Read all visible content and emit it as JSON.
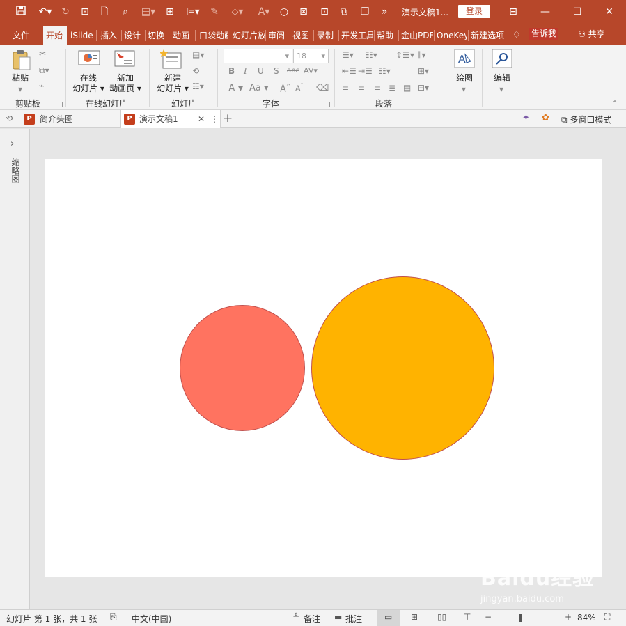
{
  "titlebar": {
    "doc_title": "演示文稿1...",
    "login": "登录"
  },
  "menu_tabs": [
    {
      "label": "文件"
    },
    {
      "label": "开始",
      "active": true
    },
    {
      "label": "iSlide"
    },
    {
      "label": "插入"
    },
    {
      "label": "设计"
    },
    {
      "label": "切换"
    },
    {
      "label": "动画"
    },
    {
      "label": "口袋动画"
    },
    {
      "label": "幻灯片放映"
    },
    {
      "label": "审阅"
    },
    {
      "label": "视图"
    },
    {
      "label": "录制"
    },
    {
      "label": "开发工具"
    },
    {
      "label": "帮助"
    },
    {
      "label": "金山PDF"
    },
    {
      "label": "OneKey"
    },
    {
      "label": "新建选项卡"
    }
  ],
  "tell_me": "告诉我",
  "share": "共享",
  "ribbon": {
    "paste": "粘贴",
    "clipboard": "剪贴板",
    "online_slide": [
      "在线",
      "幻灯片"
    ],
    "new_animation": [
      "新加",
      "动画页"
    ],
    "online_slide_group": "在线幻灯片",
    "new_slide": [
      "新建",
      "幻灯片"
    ],
    "slides_group": "幻灯片",
    "font_size": "18",
    "font_group": "字体",
    "paragraph_group": "段落",
    "drawing": "绘图",
    "editing": "编辑"
  },
  "doc_tabs": [
    {
      "label": "简介头图"
    },
    {
      "label": "演示文稿1",
      "active": true
    }
  ],
  "multi_window": "多窗口模式",
  "side_panel_label": "缩略图",
  "slide": {
    "shapes": [
      {
        "name": "red-circle",
        "fill": "#ff7360",
        "stroke": "#c0504d"
      },
      {
        "name": "orange-circle",
        "fill": "#ffb300",
        "stroke": "#c0504d"
      }
    ]
  },
  "watermark": {
    "text": "Baidu经验",
    "url": "jingyan.baidu.com"
  },
  "status": {
    "slide_info": "幻灯片 第 1 张，共 1 张",
    "language": "中文(中国)",
    "notes": "备注",
    "comments": "批注",
    "zoom": "84%",
    "zoom_level": 0.84
  },
  "colors": {
    "accent": "#b7472a",
    "ribbon_bg": "#f3f3f3"
  }
}
